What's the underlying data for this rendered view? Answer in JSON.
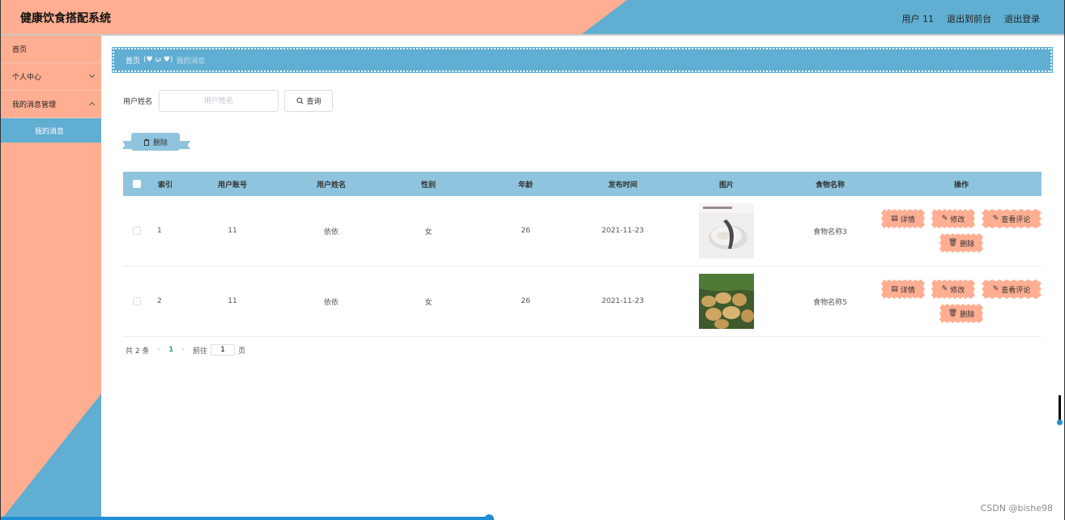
{
  "header": {
    "title": "健康饮食搭配系统",
    "user": "用户 11",
    "back_front": "退出到前台",
    "logout": "退出登录"
  },
  "sidebar": {
    "items": [
      {
        "label": "首页"
      },
      {
        "label": "个人中心"
      },
      {
        "label": "我的消息管理"
      }
    ],
    "sub_item": "我的消息"
  },
  "breadcrumb": {
    "home": "首页",
    "separator": "(♥ ω ♥)",
    "current": "我的消息"
  },
  "search": {
    "label": "用户姓名",
    "placeholder": "用户姓名",
    "value": "",
    "button": "查询"
  },
  "toolbar": {
    "delete_label": "删除"
  },
  "table": {
    "headers": [
      "索引",
      "用户账号",
      "用户姓名",
      "性别",
      "年龄",
      "发布时间",
      "图片",
      "食物名称",
      "操作"
    ],
    "rows": [
      {
        "index": "1",
        "account": "11",
        "name": "依依",
        "sex": "女",
        "age": "26",
        "time": "2021-11-23",
        "food": "食物名称3"
      },
      {
        "index": "2",
        "account": "11",
        "name": "依依",
        "sex": "女",
        "age": "26",
        "time": "2021-11-23",
        "food": "食物名称5"
      }
    ],
    "ops": {
      "detail": "详情",
      "edit": "修改",
      "comments": "查看评论",
      "delete": "删除"
    }
  },
  "pagination": {
    "total": "共 2 条",
    "current_page": "1",
    "goto_label": "前往",
    "goto_value": "1",
    "page_suffix": "页"
  },
  "watermark": "CSDN @bishe98",
  "colors": {
    "salmon": "#ffae92",
    "blue": "#60aed2",
    "light_blue": "#8ec4de"
  }
}
